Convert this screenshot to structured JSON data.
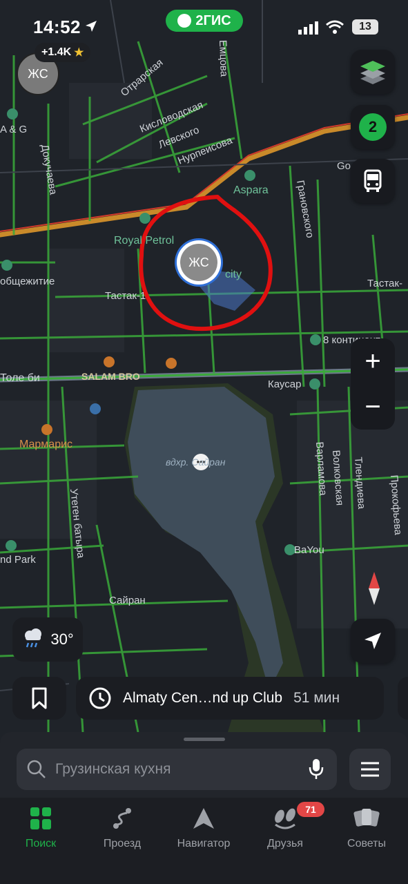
{
  "status_bar": {
    "time": "14:52",
    "brand": "2ГИС",
    "battery": "13"
  },
  "user": {
    "initials": "ЖС",
    "score": "+1.4K"
  },
  "map": {
    "labels": {
      "otrar": "Отрарская",
      "kislovod": "Кисловодская",
      "levsky": "Левского",
      "nurpeisova": "Нурпеисова",
      "emtsova": "Емцова",
      "aspara": "Aspara",
      "dokuchaeva": "Докучаева",
      "royal_petrol": "Royal Petrol",
      "city": "city",
      "dorm": "общежитие",
      "tastak1": "Тастак-1",
      "tastak_right": "Тастак-",
      "granovskogo": "Грановского",
      "kontinent": "8 континент",
      "tole_bi": "Толе би",
      "salam_bro": "SALAM BRO",
      "kausar": "Каусар",
      "marmaris": "Мармарис",
      "reservoir": "вдхр. Сайран",
      "utegen": "Утеген батыра",
      "varlamova": "Варламова",
      "volkovskaya": "Волковская",
      "tlendieva": "Тлендиева",
      "prokofieva": "Прокофьева",
      "bayou": "BaYou",
      "sairan": "Сайран",
      "nd_park": "nd Park",
      "ag": "A & G",
      "go": "Go"
    },
    "friend_marker_initials": "ЖС"
  },
  "controls": {
    "friends_count": "2",
    "zoom_in": "+",
    "zoom_out": "−"
  },
  "weather": {
    "temp": "30°"
  },
  "route": {
    "destination": "Almaty Cen…nd up Club",
    "duration": "51 мин"
  },
  "search": {
    "placeholder": "Грузинская кухня"
  },
  "tabs": [
    {
      "label": "Поиск"
    },
    {
      "label": "Проезд"
    },
    {
      "label": "Навигатор"
    },
    {
      "label": "Друзья",
      "badge": "71"
    },
    {
      "label": "Советы"
    }
  ],
  "colors": {
    "accent": "#1fb24a",
    "badge": "#e24646",
    "annotation": "#e01010",
    "traffic_green": "#3aa93a",
    "water": "#3f4d5a"
  }
}
